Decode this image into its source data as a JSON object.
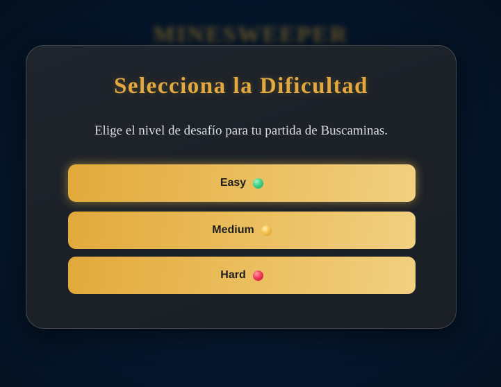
{
  "background": {
    "title": "MINESWEEPER"
  },
  "modal": {
    "title": "Selecciona la Dificultad",
    "subtitle": "Elige el nivel de desafío para tu partida de Buscaminas.",
    "options": [
      {
        "label": "Easy",
        "indicator": "green-dot-icon",
        "color": "#3fd38a",
        "highlighted": true
      },
      {
        "label": "Medium",
        "indicator": "yellow-dot-icon",
        "color": "#f5c450",
        "highlighted": false
      },
      {
        "label": "Hard",
        "indicator": "red-dot-icon",
        "color": "#ee3c5a",
        "highlighted": false
      }
    ]
  },
  "colors": {
    "accent": "#e3a93f",
    "button_start": "#e2a93b",
    "button_end": "#f1d081",
    "panel": "#1f252c",
    "backdrop": "#06182f"
  }
}
